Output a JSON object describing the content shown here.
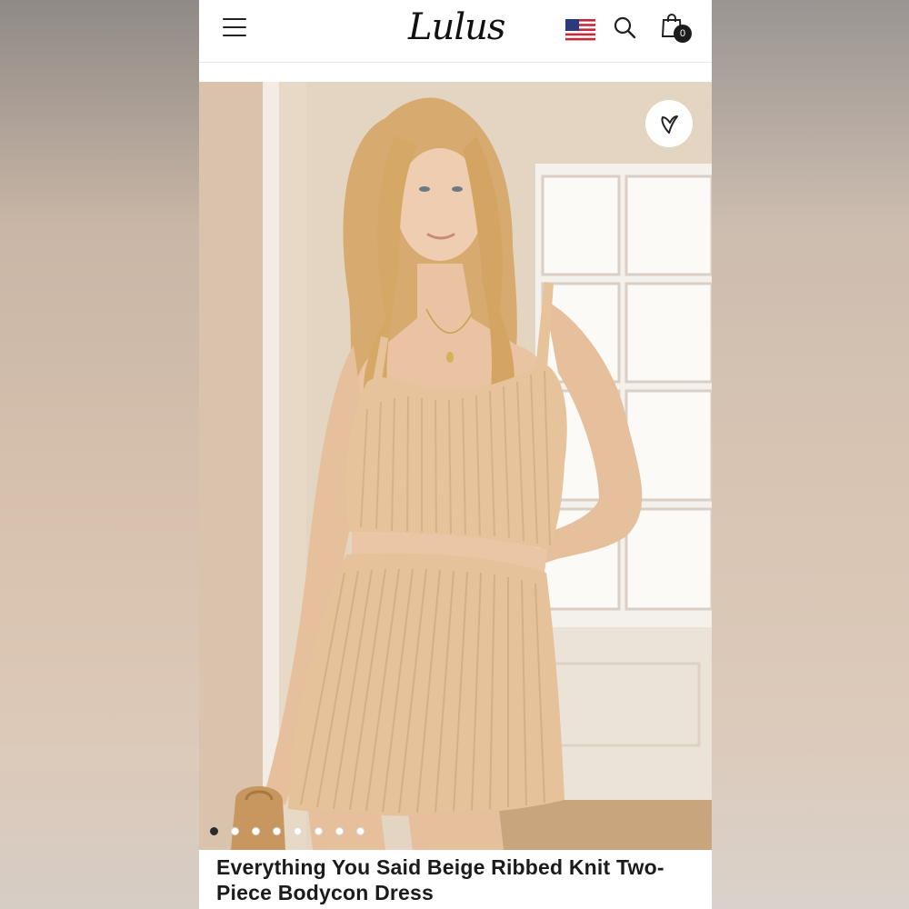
{
  "header": {
    "logo": "Lulus",
    "cart_count": "0",
    "icons": [
      "menu-icon",
      "us-flag-icon",
      "search-icon",
      "shopping-bag-icon"
    ]
  },
  "gallery": {
    "image_count": 8,
    "active_index": 0,
    "wishlist_icon": "heart-icon"
  },
  "product": {
    "title": "Everything You Said Beige Ribbed Knit Two-Piece Bodycon Dress"
  },
  "colors": {
    "accent": "#1c1c1c",
    "knit": "#e6c39a"
  }
}
